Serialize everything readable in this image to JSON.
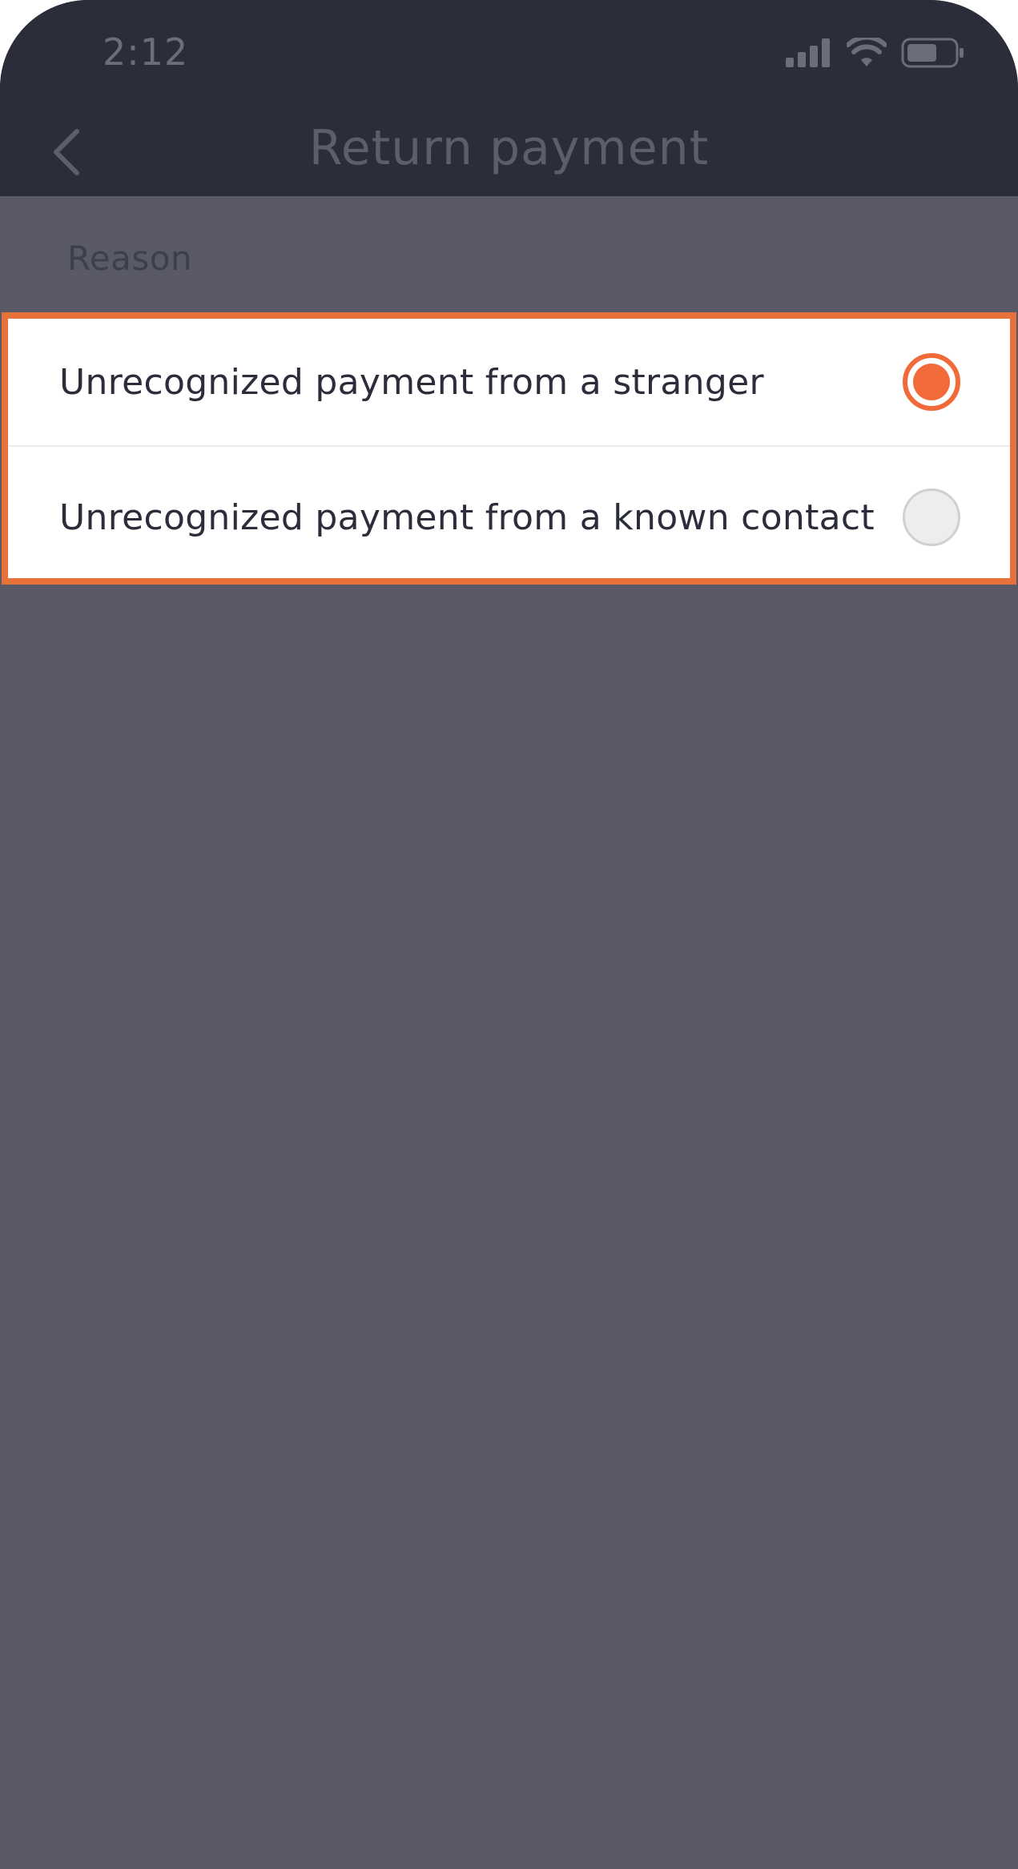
{
  "status_bar": {
    "time": "2:12",
    "icons": [
      "signal-icon",
      "wifi-icon",
      "battery-icon"
    ]
  },
  "header": {
    "title": "Return payment",
    "back_icon": "chevron-left-icon"
  },
  "section": {
    "label": "Reason"
  },
  "options": [
    {
      "label": "Unrecognized payment from a stranger",
      "selected": true
    },
    {
      "label": "Unrecognized payment from a known contact",
      "selected": false
    }
  ],
  "colors": {
    "accent": "#f26a3a",
    "highlight_border": "#e8703a",
    "topbar": "#2b2d3a",
    "overlay": "#5a5a66"
  }
}
